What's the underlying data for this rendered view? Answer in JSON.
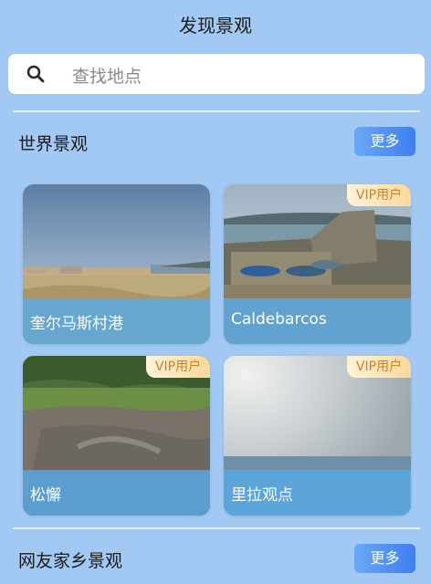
{
  "header": {
    "title": "发现景观"
  },
  "search": {
    "placeholder": "查找地点"
  },
  "sections": [
    {
      "title": "世界景观",
      "more_label": "更多"
    },
    {
      "title": "网友家乡景观",
      "more_label": "更多"
    }
  ],
  "cards": [
    {
      "name": "奎尔马斯村港",
      "vip": false
    },
    {
      "name": "Caldebarcos",
      "vip": true,
      "badge": "VIP用户"
    },
    {
      "name": "松懈",
      "vip": true,
      "badge": "VIP用户"
    },
    {
      "name": "里拉观点",
      "vip": true,
      "badge": "VIP用户"
    }
  ]
}
